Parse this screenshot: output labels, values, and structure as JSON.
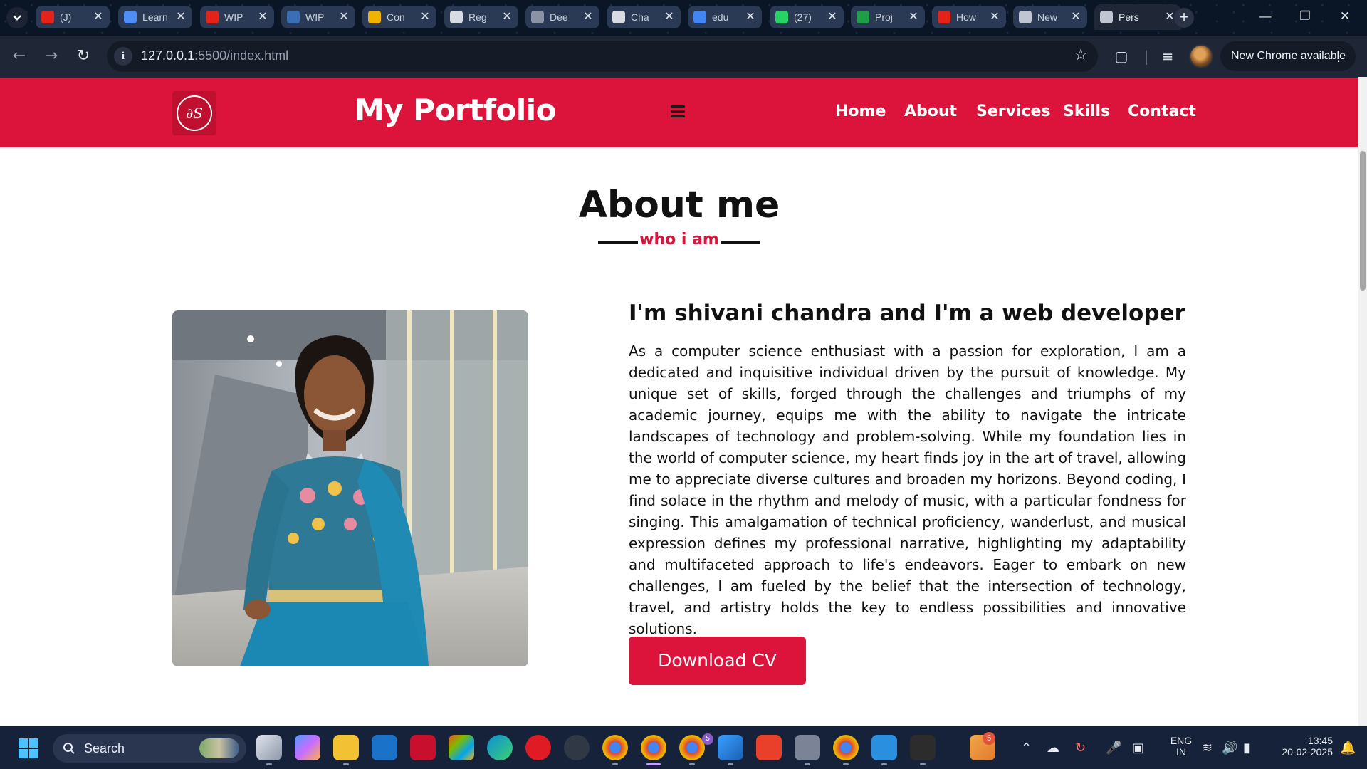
{
  "browser": {
    "tabs": [
      {
        "title": "(J)",
        "favicon": "youtube-icon",
        "color": "#e62117"
      },
      {
        "title": "Learn",
        "favicon": "learn-icon",
        "color": "#4f8ef7"
      },
      {
        "title": "WIP",
        "favicon": "youtube-icon",
        "color": "#e62117"
      },
      {
        "title": "WIP",
        "favicon": "wordpress-icon",
        "color": "#3a6fb5"
      },
      {
        "title": "Con",
        "favicon": "colorful-icon",
        "color": "#f0b400"
      },
      {
        "title": "Reg",
        "favicon": "openai-icon",
        "color": "#d8dce2"
      },
      {
        "title": "Dee",
        "favicon": "globe-icon",
        "color": "#8a93a6"
      },
      {
        "title": "Cha",
        "favicon": "openai-icon",
        "color": "#d8dce2"
      },
      {
        "title": "edu",
        "favicon": "google-icon",
        "color": "#4285f4"
      },
      {
        "title": "(27)",
        "favicon": "whatsapp-icon",
        "color": "#25d366"
      },
      {
        "title": "Proj",
        "favicon": "mongodb-icon",
        "color": "#1f9e4a"
      },
      {
        "title": "How",
        "favicon": "youtube-icon",
        "color": "#e62117"
      },
      {
        "title": "New",
        "favicon": "chrome-icon",
        "color": "#bfc6d2"
      },
      {
        "title": "Pers",
        "favicon": "globe-icon",
        "color": "#bfc6d2",
        "active": true
      }
    ],
    "url_host": "127.0.0.1",
    "url_path": ":5500/index.html",
    "update_label": "New Chrome available"
  },
  "site": {
    "title": "My Portfolio",
    "logo_text": "∂S",
    "nav": [
      "Home",
      "About",
      "Services",
      "Skills",
      "Contact"
    ],
    "accent": "#dc143c"
  },
  "about": {
    "title": "About me",
    "subtitle": "who i am",
    "heading": "I'm shivani chandra and I'm a web developer",
    "body": "As a computer science enthusiast with a passion for exploration, I am a dedicated and inquisitive individual driven by the pursuit of knowledge. My unique set of skills, forged through the challenges and triumphs of my academic journey, equips me with the ability to navigate the intricate landscapes of technology and problem-solving. While my foundation lies in the world of computer science, my heart finds joy in the art of travel, allowing me to appreciate diverse cultures and broaden my horizons. Beyond coding, I find solace in the rhythm and melody of music, with a particular fondness for singing. This amalgamation of technical proficiency, wanderlust, and musical expression defines my professional narrative, highlighting my adaptability and multifaceted approach to life's endeavors. Eager to embark on new challenges, I am fueled by the belief that the intersection of technology, travel, and artistry holds the key to endless possibilities and innovative solutions.",
    "cta": "Download CV"
  },
  "taskbar": {
    "search_label": "Search",
    "lang": "ENG",
    "region": "IN",
    "time": "13:45",
    "date": "20-02-2025",
    "notification_badge": "5",
    "chrome_badge": "5"
  }
}
